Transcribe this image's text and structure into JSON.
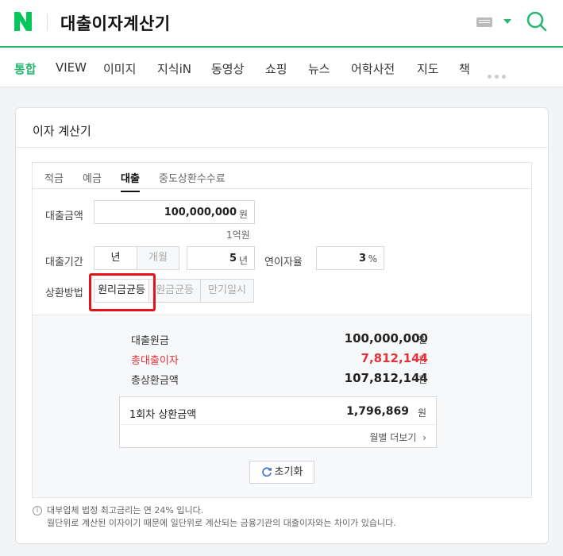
{
  "header": {
    "query": "대출이자계산기",
    "logo_letter": "N"
  },
  "nav_tabs": [
    "통합",
    "VIEW",
    "이미지",
    "지식iN",
    "동영상",
    "쇼핑",
    "뉴스",
    "어학사전",
    "지도",
    "책"
  ],
  "calculator": {
    "title": "이자 계산기",
    "subtabs": [
      "적금",
      "예금",
      "대출",
      "중도상환수수료"
    ],
    "active_subtab": "대출",
    "loan_amount_label": "대출금액",
    "loan_amount_value": "100,000,000",
    "loan_amount_unit": "원",
    "loan_amount_hint": "1억원",
    "period_label": "대출기간",
    "period_unit_options": [
      "년",
      "개월"
    ],
    "period_value": "5",
    "period_unit": "년",
    "rate_label": "연이자율",
    "rate_value": "3",
    "rate_unit": "%",
    "repay_label": "상환방법",
    "repay_options": [
      "원리금균등",
      "원금균등",
      "만기일시"
    ],
    "repay_selected": "원리금균등"
  },
  "result": {
    "principal_label": "대출원금",
    "principal_value": "100,000,000",
    "interest_label": "총대출이자",
    "interest_value": "7,812,144",
    "total_label": "총상환금액",
    "total_value": "107,812,144",
    "unit": "원",
    "first_payment_label": "1회차 상환금액",
    "first_payment_value": "1,796,869",
    "monthly_more": "월별 더보기",
    "reset_label": "초기화"
  },
  "notes": {
    "line1": "대부업체 법정 최고금리는 연 24% 입니다.",
    "line2": "월단위로 계산된 이자이기 때문에 일단위로 계산되는 금융기관의 대출이자와는 차이가 있습니다."
  },
  "colors": {
    "brand": "#2bb673",
    "highlight": "#e8121a",
    "interest_red": "#e3323b"
  }
}
